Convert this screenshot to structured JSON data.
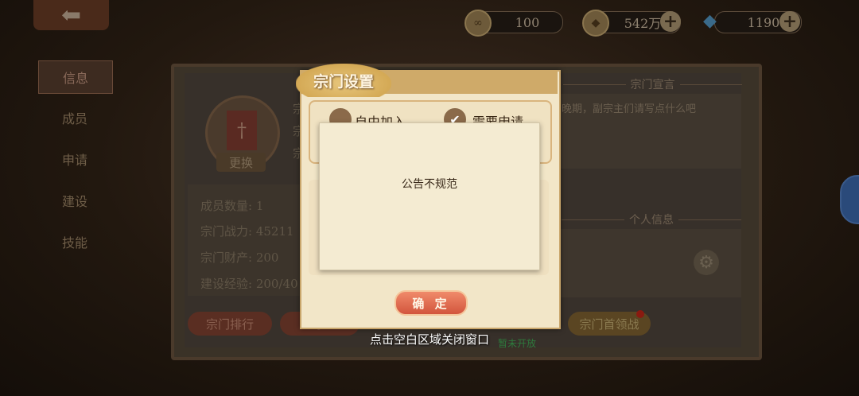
{
  "resources": [
    {
      "icon": "coin-icon",
      "value": "100",
      "has_plus": false
    },
    {
      "icon": "copper-coin-icon",
      "value": "542万",
      "has_plus": true
    },
    {
      "icon": "crystal-icon",
      "value": "1190",
      "has_plus": true
    }
  ],
  "nav": [
    {
      "label": "信息",
      "active": true
    },
    {
      "label": "成员",
      "active": false
    },
    {
      "label": "申请",
      "active": false
    },
    {
      "label": "建设",
      "active": false
    },
    {
      "label": "技能",
      "active": false
    }
  ],
  "sect": {
    "change_label": "更换",
    "announcement_head": "宗门宣言",
    "announcement_text": "晚期，副宗主们请写点什么吧",
    "personal_head": "个人信息",
    "stats": [
      {
        "label": "成员数量:",
        "value": "1"
      },
      {
        "label": "宗门战力:",
        "value": "45211"
      },
      {
        "label": "宗门财产:",
        "value": "200"
      },
      {
        "label": "建设经验:",
        "value": "200/40"
      }
    ],
    "partial_left": "宗",
    "partial_left2": "吧",
    "partial_right": "么"
  },
  "bottom_buttons": {
    "rank": "宗门排行",
    "partial": "宗",
    "boss": "宗门首领战",
    "not_open": "暂未开放"
  },
  "dialog": {
    "title": "宗门设置",
    "option_free": "自由加入",
    "option_apply": "需要申请",
    "option_free_checked": false,
    "option_apply_checked": true,
    "confirm": "确 定"
  },
  "toast": {
    "message": "公告不规范"
  },
  "close_hint": "点击空白区域关闭窗口"
}
